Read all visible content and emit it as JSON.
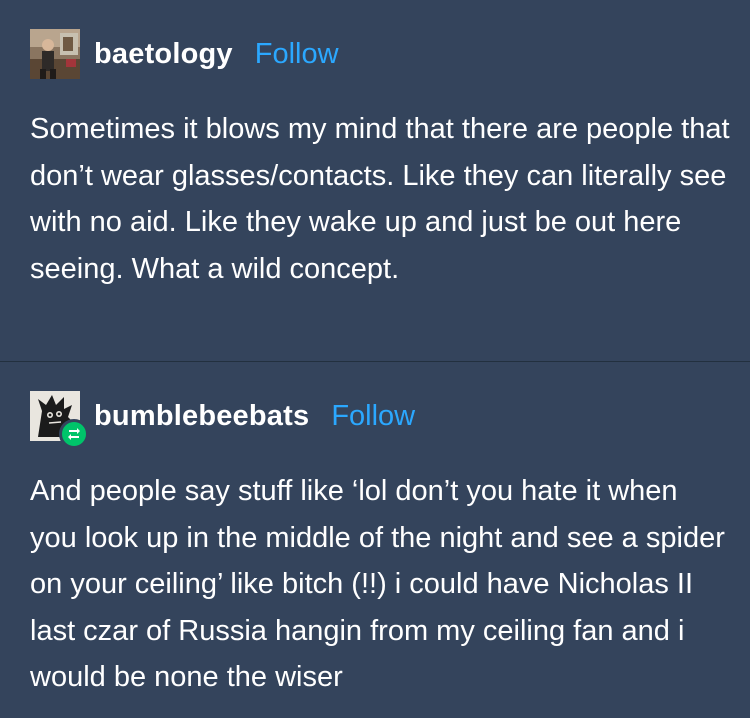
{
  "posts": [
    {
      "username": "baetology",
      "follow_label": "Follow",
      "avatar_icon": "photo-avatar-icon",
      "text": "Sometimes it blows my mind that there are people that don’t wear glasses/contacts. Like they can literally see with no aid. Like they wake up and just be out here seeing. What a wild concept."
    },
    {
      "username": "bumblebeebats",
      "follow_label": "Follow",
      "avatar_icon": "cartoon-creature-avatar-icon",
      "badge_icon": "reblog-icon",
      "text": "And people say stuff like ‘lol don’t you hate it when you look up in the middle of the night and see a spider on your ceiling’ like bitch (!!) i could have Nicholas II last czar of Russia hangin from my ceiling fan and i would be none the wiser"
    }
  ],
  "colors": {
    "background": "#34445c",
    "follow": "#2ba8ff",
    "text": "#ffffff",
    "reblog_badge": "#00c46a"
  }
}
